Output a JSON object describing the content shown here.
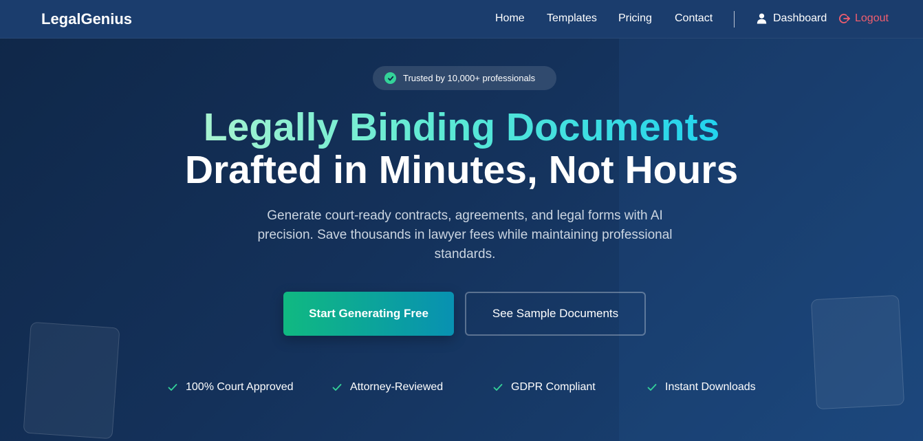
{
  "navbar": {
    "logo": "LegalGenius",
    "links": [
      "Home",
      "Templates",
      "Pricing",
      "Contact"
    ],
    "dashboard_label": "Dashboard",
    "logout_label": "Logout"
  },
  "hero": {
    "badge": "Trusted by 10,000+ professionals",
    "headline_gradient": "Legally Binding Documents",
    "headline_plain": "Drafted in Minutes, Not Hours",
    "subtext": "Generate court-ready contracts, agreements, and legal forms with AI precision. Save thousands in lawyer fees while maintaining professional standards.",
    "primary_cta": "Start Generating Free",
    "secondary_cta": "See Sample Documents"
  },
  "features": [
    "100% Court Approved",
    "Attorney-Reviewed",
    "GDPR Compliant",
    "Instant Downloads"
  ],
  "colors": {
    "accent_green": "#10b981",
    "accent_cyan": "#0891b2",
    "logout_red": "#f25e6e",
    "check_green": "#34d399"
  },
  "icons": [
    "user-icon",
    "logout-icon",
    "check-circle-icon",
    "check-icon"
  ]
}
